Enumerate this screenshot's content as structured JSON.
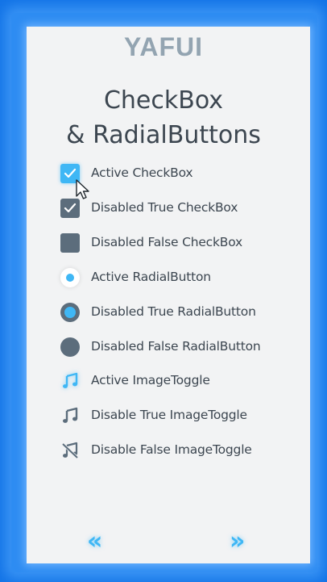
{
  "brand": "YAFUI",
  "title_line1": "CheckBox",
  "title_line2": "& RadialButtons",
  "items": [
    {
      "label": "Active CheckBox",
      "kind": "checkbox",
      "state": "active",
      "checked": true
    },
    {
      "label": "Disabled True CheckBox",
      "kind": "checkbox",
      "state": "disabled",
      "checked": true
    },
    {
      "label": "Disabled False CheckBox",
      "kind": "checkbox",
      "state": "disabled",
      "checked": false
    },
    {
      "label": "Active RadialButton",
      "kind": "radial",
      "state": "active",
      "checked": true
    },
    {
      "label": "Disabled True RadialButton",
      "kind": "radial",
      "state": "disabled",
      "checked": true
    },
    {
      "label": "Disabled False RadialButton",
      "kind": "radial",
      "state": "disabled",
      "checked": false
    },
    {
      "label": "Active ImageToggle",
      "kind": "image-toggle",
      "state": "active",
      "icon": "music-note-icon"
    },
    {
      "label": "Disable True ImageToggle",
      "kind": "image-toggle",
      "state": "disabled",
      "icon": "music-note-icon"
    },
    {
      "label": "Disable False ImageToggle",
      "kind": "image-toggle",
      "state": "disabled",
      "icon": "music-note-muted-icon"
    }
  ],
  "nav": {
    "prev_label": "«",
    "next_label": "»"
  },
  "colors": {
    "background": "#1273e6",
    "panel": "#f2f3f4",
    "accent": "#3fb7f5",
    "disabled": "#5c6d7c",
    "brand_text": "#93a4b1",
    "text": "#3c4650"
  }
}
